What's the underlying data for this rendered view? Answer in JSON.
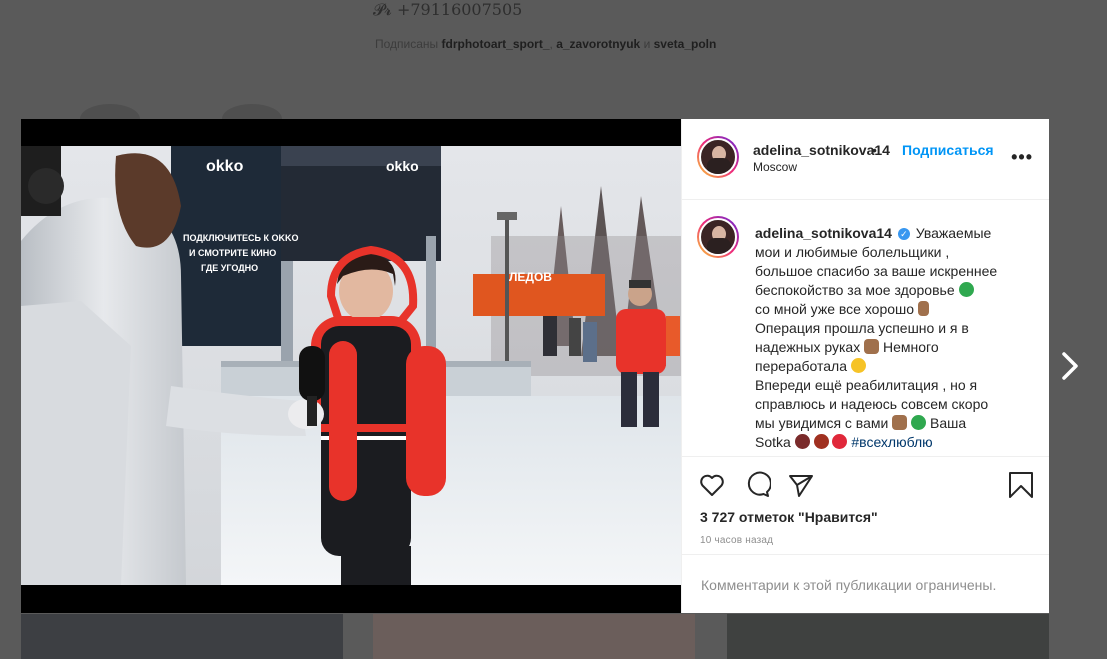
{
  "background": {
    "phone_prefix": "𝓟𝓻",
    "phone": "+79116007505",
    "followed_by_prefix": "Подписаны",
    "followed_by": [
      "fdrphotoart_sport_",
      "a_zavorotnyuk",
      "sveta_poln"
    ],
    "separator": ",",
    "and": "и"
  },
  "post": {
    "username_header": "adelina_sotnikova14",
    "dot": "•",
    "follow_label": "Подписаться",
    "location": "Moscow",
    "more_label": "•••",
    "caption": {
      "username": "adelina_sotnikova14",
      "verified_mark": "✓",
      "lines": [
        "Уважаемые",
        "мои и любимые болельщики ,",
        "большое спасибо за ваше искреннее",
        "беспокойство за мое здоровье",
        "со мной уже все хорошо",
        "Операция прошла успешно и я в",
        "надежных руках",
        "Немного",
        "переработала",
        "Впереди ещё реабилитация , но я",
        "справлюсь и надеюсь совсем скоро",
        "мы увидимся с вами",
        "Ваша",
        "Sotka",
        "#всехлюблю"
      ]
    },
    "likes_text": "3 727 отметок \"Нравится\"",
    "time_text": "10 часов назад",
    "comments_disabled_text": "Комментарии к этой публикации ограничены."
  },
  "photo_signs": {
    "brand": "okko",
    "banner_lines": [
      "ПОДКЛЮЧИТЕСЬ К OKKO",
      "И СМОТРИТЕ КИНО",
      "ГДЕ УГОДНО"
    ],
    "building_sign": "ЛЕДОВ"
  },
  "colors": {
    "accent": "#0095f6",
    "text": "#262626",
    "muted": "#8e8e8e",
    "hashtag": "#00376b",
    "jacket_red": "#e8332a"
  },
  "icons": [
    "heart-icon",
    "comment-icon",
    "share-icon",
    "bookmark-icon",
    "next-arrow-icon",
    "verified-icon"
  ]
}
